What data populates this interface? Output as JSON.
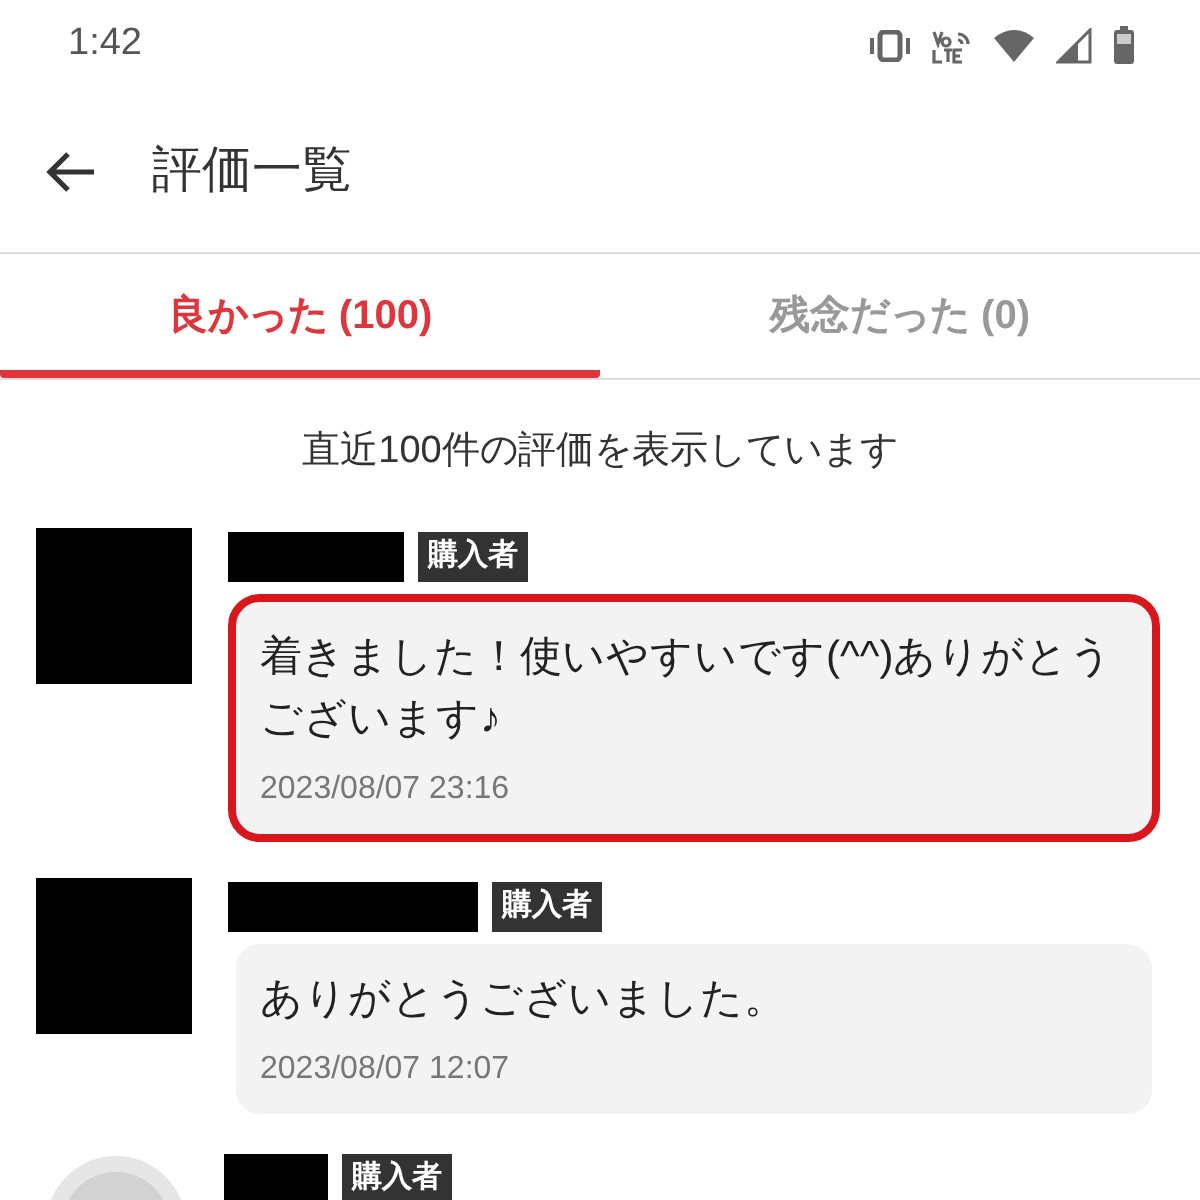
{
  "status_bar": {
    "time": "1:42"
  },
  "header": {
    "title": "評価一覧"
  },
  "tabs": [
    {
      "label": "良かった (100)",
      "selected": true
    },
    {
      "label": "残念だった (0)",
      "selected": false
    }
  ],
  "notice": "直近100件の評価を表示しています",
  "reviews": [
    {
      "kind": "hidden",
      "badge": "購入者",
      "text": "着きました！使いやすいです(^^)ありがとうございます♪",
      "date": "2023/08/07 23:16",
      "highlighted": true
    },
    {
      "kind": "hidden",
      "badge": "購入者",
      "text": "ありがとうございました。",
      "date": "2023/08/07 12:07",
      "highlighted": false
    },
    {
      "kind": "default",
      "badge": "購入者"
    }
  ]
}
